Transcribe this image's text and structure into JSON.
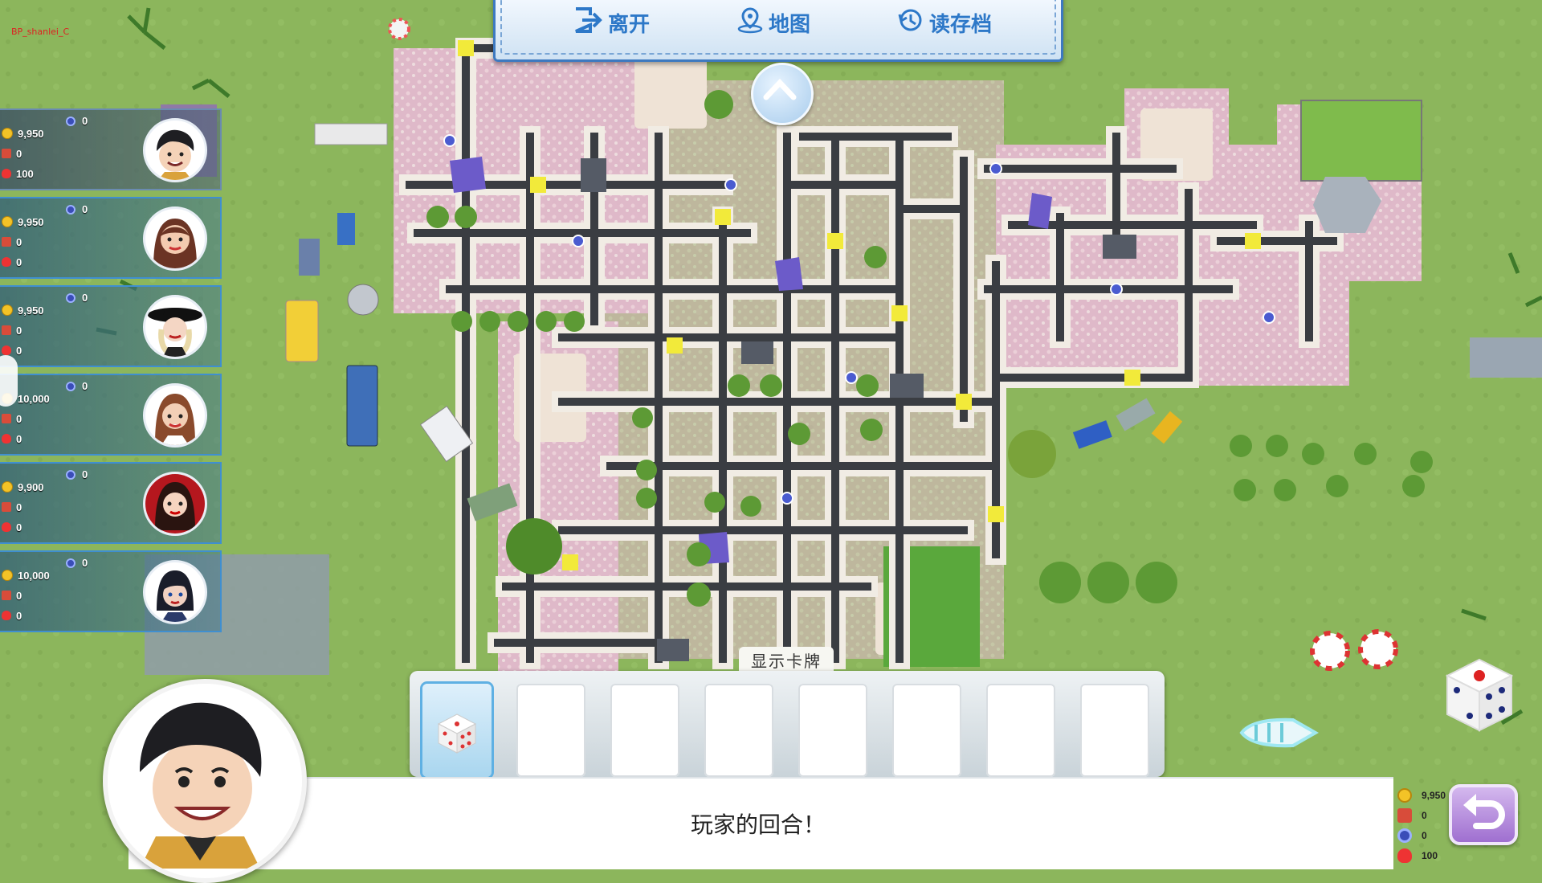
{
  "username": "BP_shanlei_C",
  "menu": {
    "leave_label": "离开",
    "map_label": "地图",
    "save_load_label": "读存档"
  },
  "players": [
    {
      "money": "9,950",
      "property": "0",
      "health": "100",
      "gems": "0",
      "active": true
    },
    {
      "money": "9,950",
      "property": "0",
      "health": "0",
      "gems": "0",
      "active": false
    },
    {
      "money": "9,950",
      "property": "0",
      "health": "0",
      "gems": "0",
      "active": false
    },
    {
      "money": "10,000",
      "property": "0",
      "health": "0",
      "gems": "0",
      "active": false
    },
    {
      "money": "9,900",
      "property": "0",
      "health": "0",
      "gems": "0",
      "active": false
    },
    {
      "money": "10,000",
      "property": "0",
      "health": "0",
      "gems": "0",
      "active": false
    }
  ],
  "cards": {
    "show_cards_label": "显示卡牌",
    "slots": [
      "dice-card",
      "",
      "",
      "",
      "",
      "",
      "",
      ""
    ]
  },
  "message": "玩家的回合！",
  "current_player": {
    "money": "9,950",
    "property": "0",
    "gems": "0",
    "health": "100"
  },
  "colors": {
    "accent": "#2d78c8",
    "panel_border": "#3f8fd0",
    "grass": "#8cb65c",
    "road": "#3a3d42",
    "flowers": "#f2b6d8"
  },
  "icons": {
    "leave": "exit-icon",
    "map": "map-pin-icon",
    "save": "save-load-icon",
    "up": "chevron-up-icon",
    "dice": "dice-icon",
    "back": "undo-arrow-icon"
  }
}
